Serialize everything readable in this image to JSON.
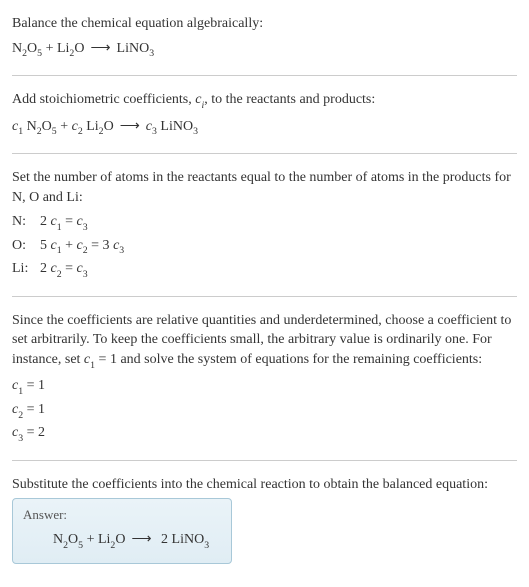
{
  "header": {
    "title": "Balance the chemical equation algebraically:"
  },
  "initial_equation": {
    "r1_base": "N",
    "r1_s1": "2",
    "r1_mid": "O",
    "r1_s2": "5",
    "plus1": " + ",
    "r2_base": "Li",
    "r2_s1": "2",
    "r2_mid": "O",
    "arrow": "⟶",
    "p1_base": "LiNO",
    "p1_s1": "3"
  },
  "stoich_intro": {
    "text_a": "Add stoichiometric coefficients, ",
    "ci_c": "c",
    "ci_i": "i",
    "text_b": ", to the reactants and products:"
  },
  "stoich_eq": {
    "c1_c": "c",
    "c1_1": "1",
    "sp1": " ",
    "r1_base": "N",
    "r1_s1": "2",
    "r1_mid": "O",
    "r1_s2": "5",
    "plus1": " + ",
    "c2_c": "c",
    "c2_1": "2",
    "sp2": " ",
    "r2_base": "Li",
    "r2_s1": "2",
    "r2_mid": "O",
    "arrow": "⟶",
    "c3_c": "c",
    "c3_1": "3",
    "sp3": " ",
    "p1_base": "LiNO",
    "p1_s1": "3"
  },
  "atoms_intro": "Set the number of atoms in the reactants equal to the number of atoms in the products for N, O and Li:",
  "atoms": {
    "n_label": "N:",
    "n_eq": {
      "a": "2 ",
      "c1c": "c",
      "c1s": "1",
      "eq": " = ",
      "c3c": "c",
      "c3s": "3"
    },
    "o_label": "O:",
    "o_eq": {
      "a": "5 ",
      "c1c": "c",
      "c1s": "1",
      "p": " + ",
      "c2c": "c",
      "c2s": "2",
      "eq": " = 3 ",
      "c3c": "c",
      "c3s": "3"
    },
    "li_label": "Li:",
    "li_eq": {
      "a": "2 ",
      "c2c": "c",
      "c2s": "2",
      "eq": " = ",
      "c3c": "c",
      "c3s": "3"
    }
  },
  "underdet": {
    "text_a": "Since the coefficients are relative quantities and underdetermined, choose a coefficient to set arbitrarily. To keep the coefficients small, the arbitrary value is ordinarily one. For instance, set ",
    "c1c": "c",
    "c1s": "1",
    "text_b": " = 1 and solve the system of equations for the remaining coefficients:"
  },
  "solutions": {
    "l1": {
      "cc": "c",
      "cs": "1",
      "eq": " = 1"
    },
    "l2": {
      "cc": "c",
      "cs": "2",
      "eq": " = 1"
    },
    "l3": {
      "cc": "c",
      "cs": "3",
      "eq": " = 2"
    }
  },
  "subst_intro": "Substitute the coefficients into the chemical reaction to obtain the balanced equation:",
  "answer": {
    "label": "Answer:",
    "eq": {
      "r1_base": "N",
      "r1_s1": "2",
      "r1_mid": "O",
      "r1_s2": "5",
      "plus1": " + ",
      "r2_base": "Li",
      "r2_s1": "2",
      "r2_mid": "O",
      "arrow": "⟶",
      "coef": " 2 ",
      "p1_base": "LiNO",
      "p1_s1": "3"
    }
  }
}
